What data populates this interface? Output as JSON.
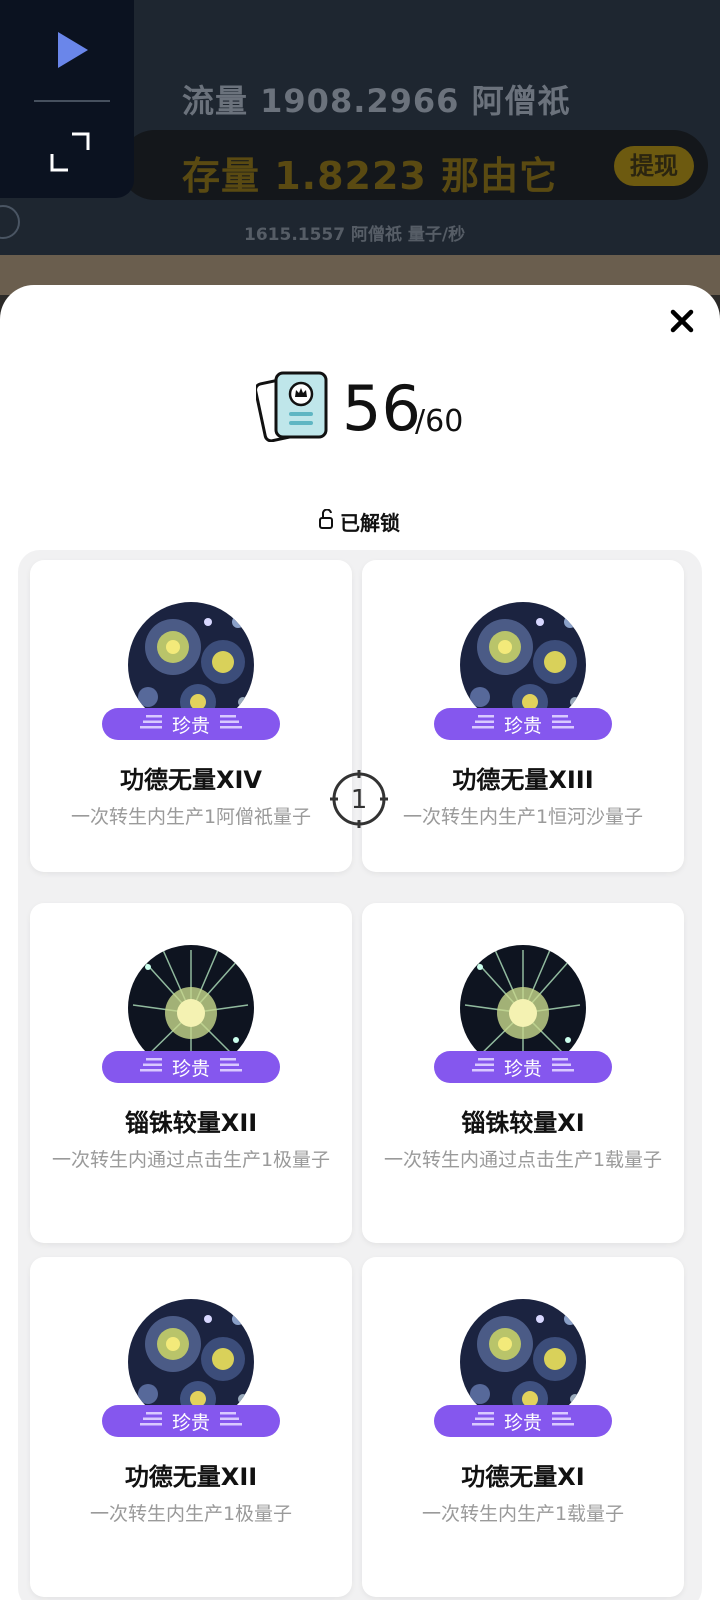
{
  "background": {
    "flow_text": "流量 1908.2966 阿僧祇",
    "flow_overlay": "",
    "stock_text": "存量 1.8223 那由它",
    "withdraw_label": "提现",
    "rate_text": "1615.1557 阿僧祇  量子/秒"
  },
  "player": {
    "play_icon": "play-icon",
    "expand_icon": "expand-icon"
  },
  "sheet": {
    "close_icon": "close-icon",
    "collection_icon": "cards-icon",
    "count_current": "56",
    "count_total": "/60",
    "unlock_icon": "unlock-icon",
    "unlock_label": "已解锁"
  },
  "cards": [
    {
      "badge": "珍贵",
      "title": "功德无量XIV",
      "desc": "一次转生内生产1阿僧祇量子",
      "image": "galaxy"
    },
    {
      "badge": "珍贵",
      "title": "功德无量XIII",
      "desc": "一次转生内生产1恒河沙量子",
      "image": "galaxy"
    },
    {
      "badge": "珍贵",
      "title": "锱铢较量XII",
      "desc": "一次转生内通过点击生产1极量子",
      "image": "burst"
    },
    {
      "badge": "珍贵",
      "title": "锱铢较量XI",
      "desc": "一次转生内通过点击生产1载量子",
      "image": "burst"
    },
    {
      "badge": "珍贵",
      "title": "功德无量XII",
      "desc": "一次转生内生产1极量子",
      "image": "galaxy"
    },
    {
      "badge": "珍贵",
      "title": "功德无量XI",
      "desc": "一次转生内生产1载量子",
      "image": "galaxy"
    }
  ],
  "overlay": {
    "cursor_number": "1"
  },
  "colors": {
    "badge_purple": "#8557ee",
    "sheet_bg": "#ffffff",
    "grid_bg": "#f1f1f2",
    "header_bg": "#1e2630"
  }
}
